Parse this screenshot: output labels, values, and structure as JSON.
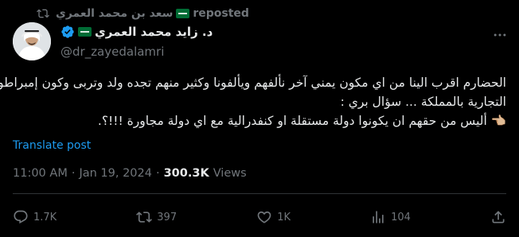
{
  "repost": {
    "author": "سعد بن محمد العمري",
    "label": "reposted"
  },
  "author": {
    "name": "د. زايد محمد العمري",
    "handle": "@dr_zayedalamri"
  },
  "post": {
    "lines": [
      "الحضارم اقرب الينا من اي مكون يمني آخر نألفهم ويألفونا وكثير منهم تجده ولد وتربى وكون إمبراطوريته",
      "التجارية بالمملكة ... سؤال بري :",
      "👈🏼 أليس من حقهم ان يكونوا دولة مستقلة او كنفدرالية مع اي دولة مجاورة !!!؟."
    ],
    "translate_label": "Translate post"
  },
  "meta": {
    "time": "11:00 AM",
    "sep": "·",
    "date": "Jan 19, 2024",
    "views_count": "300.3K",
    "views_label": "Views"
  },
  "actions": {
    "replies": "1.7K",
    "reposts": "397",
    "likes": "1K",
    "views": "104"
  },
  "icons": {
    "verified": "verified-badge-icon",
    "flag": "saudi-flag-icon"
  },
  "colors": {
    "background": "#000000",
    "text": "#e7e9ea",
    "muted": "#71767b",
    "accent": "#1d9bf0",
    "divider": "#2f3336"
  }
}
